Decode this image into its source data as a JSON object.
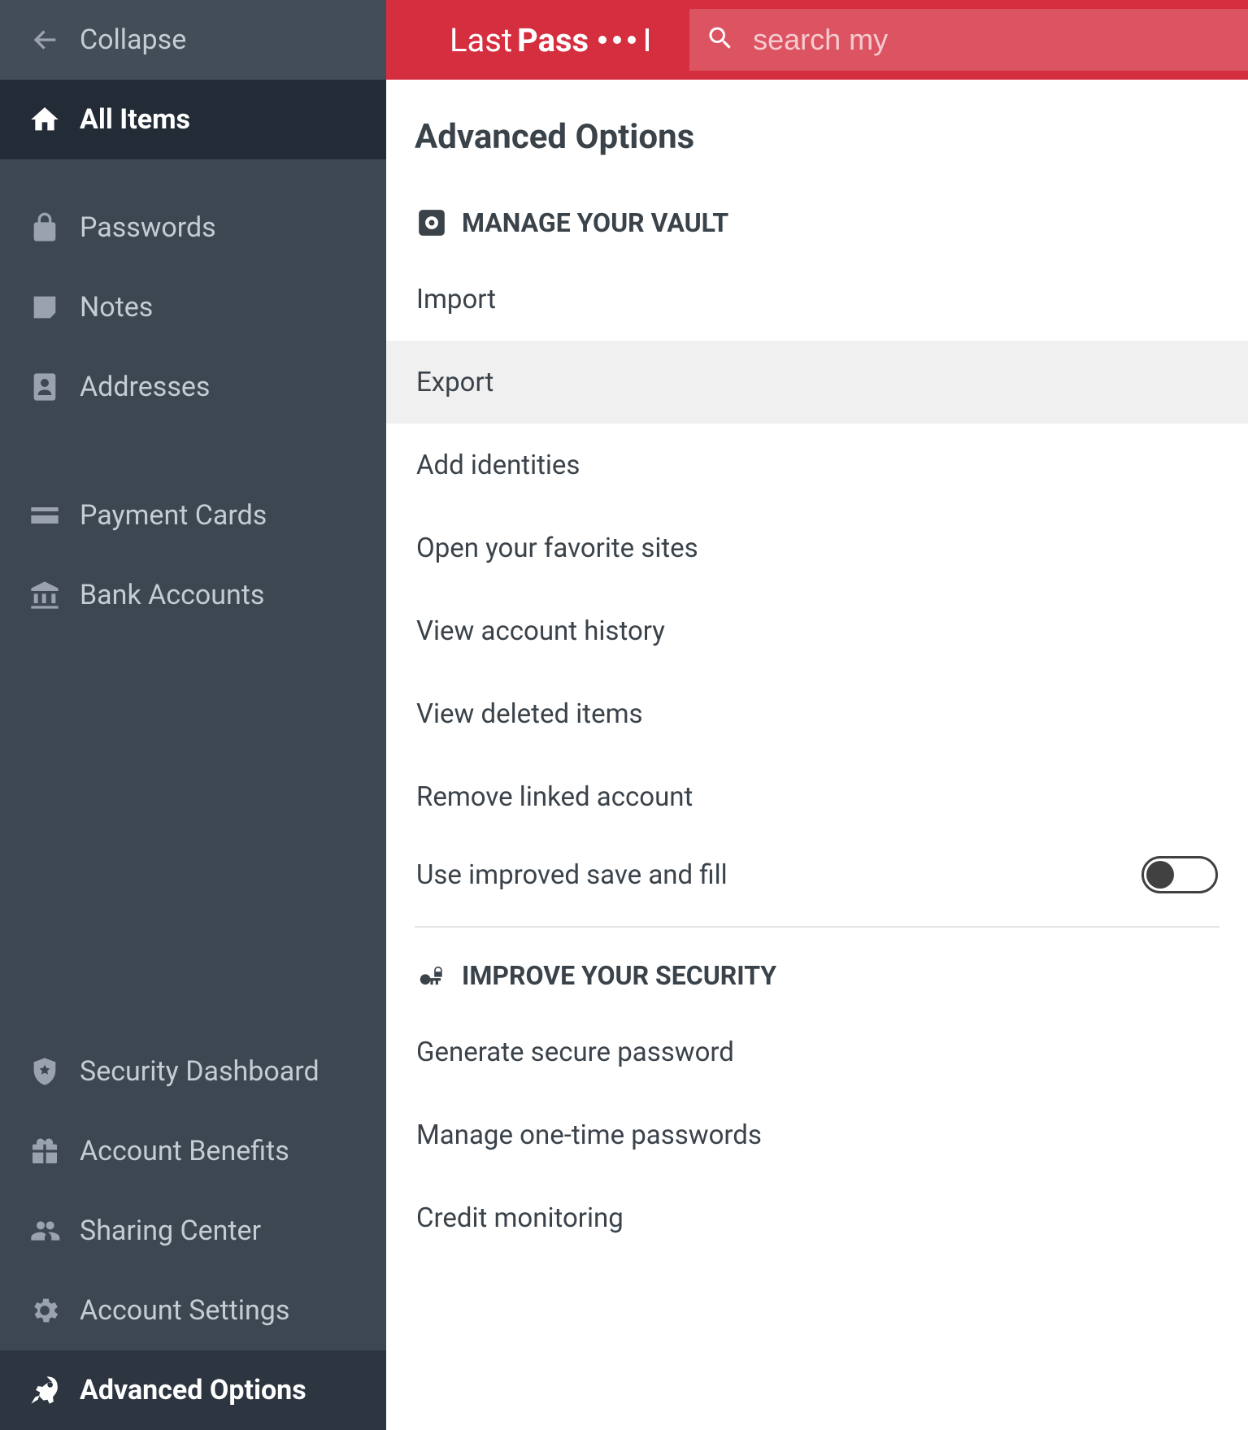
{
  "sidebar": {
    "collapse": "Collapse",
    "items": [
      {
        "label": "All Items"
      },
      {
        "label": "Passwords"
      },
      {
        "label": "Notes"
      },
      {
        "label": "Addresses"
      },
      {
        "label": "Payment Cards"
      },
      {
        "label": "Bank Accounts"
      },
      {
        "label": "Security Dashboard"
      },
      {
        "label": "Account Benefits"
      },
      {
        "label": "Sharing Center"
      },
      {
        "label": "Account Settings"
      },
      {
        "label": "Advanced Options"
      }
    ]
  },
  "topbar": {
    "logo_last": "Last",
    "logo_pass": "Pass",
    "search_placeholder": "search my"
  },
  "page": {
    "title": "Advanced Options",
    "sections": {
      "vault": {
        "title": "MANAGE YOUR VAULT",
        "items": [
          "Import",
          "Export",
          "Add identities",
          "Open your favorite sites",
          "View account history",
          "View deleted items",
          "Remove linked account",
          "Use improved save and fill"
        ],
        "toggle_on": false
      },
      "security": {
        "title": "IMPROVE YOUR SECURITY",
        "items": [
          "Generate secure password",
          "Manage one-time passwords",
          "Credit monitoring"
        ]
      }
    }
  }
}
